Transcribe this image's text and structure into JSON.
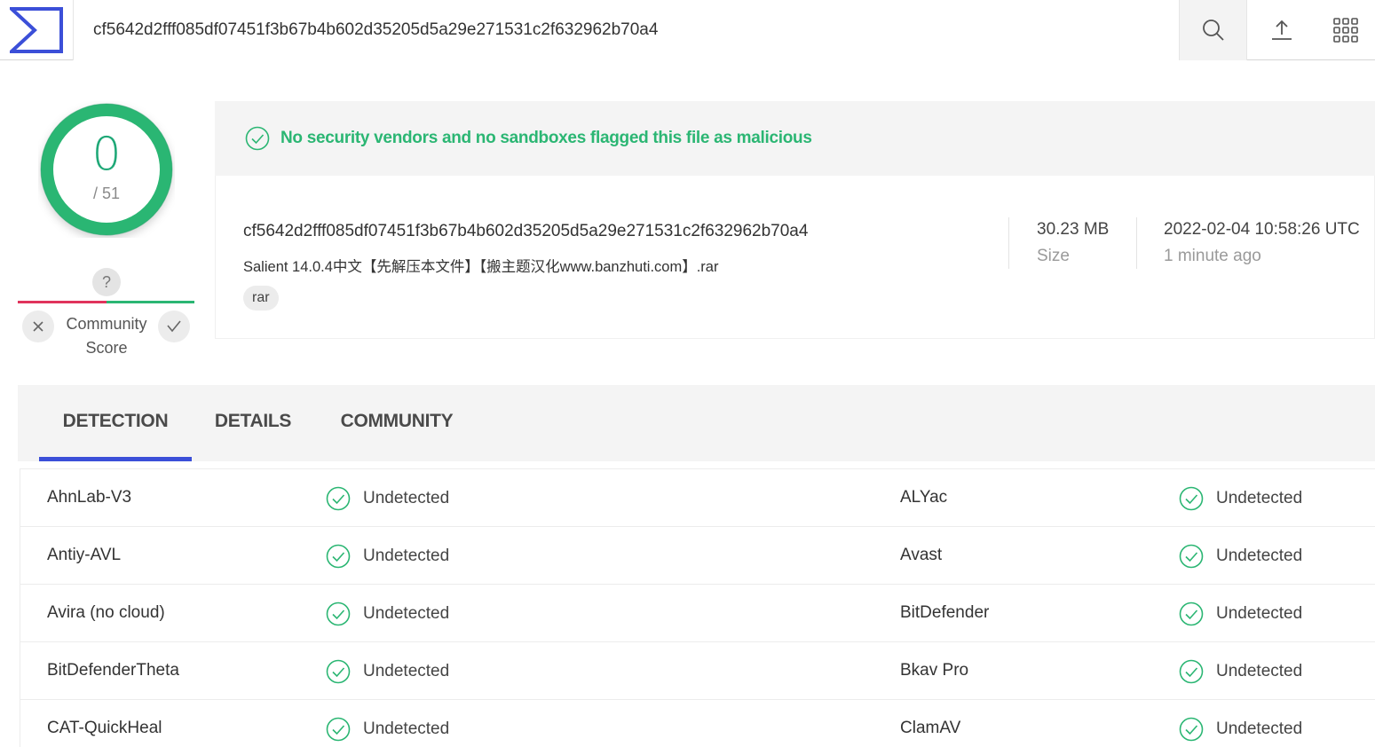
{
  "topbar": {
    "logo": "virustotal-logo",
    "search_value": "cf5642d2fff085df07451f3b67b4b602d35205d5a29e271531c2f632962b70a4",
    "icons": [
      "search-icon",
      "upload-icon",
      "apps-grid-icon"
    ]
  },
  "score": {
    "detections": "0",
    "total": "/ 51",
    "ring_color": "#2bb673"
  },
  "community": {
    "unknown_symbol": "?",
    "label_line1": "Community",
    "label_line2": "Score"
  },
  "banner": {
    "text": "No security vendors and no sandboxes flagged this file as malicious",
    "color": "#2bb673"
  },
  "file": {
    "hash": "cf5642d2fff085df07451f3b67b4b602d35205d5a29e271531c2f632962b70a4",
    "name": "Salient 14.0.4中文【先解压本文件】【搬主题汉化www.banzhuti.com】.rar",
    "tag": "rar",
    "size_value": "30.23 MB",
    "size_label": "Size",
    "date_value": "2022-02-04 10:58:26 UTC",
    "date_label": "1 minute ago"
  },
  "tabs": [
    {
      "label": "DETECTION",
      "active": true
    },
    {
      "label": "DETAILS",
      "active": false
    },
    {
      "label": "COMMUNITY",
      "active": false
    }
  ],
  "results": [
    {
      "left_engine": "AhnLab-V3",
      "left_result": "Undetected",
      "right_engine": "ALYac",
      "right_result": "Undetected"
    },
    {
      "left_engine": "Antiy-AVL",
      "left_result": "Undetected",
      "right_engine": "Avast",
      "right_result": "Undetected"
    },
    {
      "left_engine": "Avira (no cloud)",
      "left_result": "Undetected",
      "right_engine": "BitDefender",
      "right_result": "Undetected"
    },
    {
      "left_engine": "BitDefenderTheta",
      "left_result": "Undetected",
      "right_engine": "Bkav Pro",
      "right_result": "Undetected"
    },
    {
      "left_engine": "CAT-QuickHeal",
      "left_result": "Undetected",
      "right_engine": "ClamAV",
      "right_result": "Undetected"
    }
  ],
  "colors": {
    "accent_blue": "#3b4fd8",
    "safe_green": "#2bb673",
    "malicious_red": "#e0335c"
  }
}
